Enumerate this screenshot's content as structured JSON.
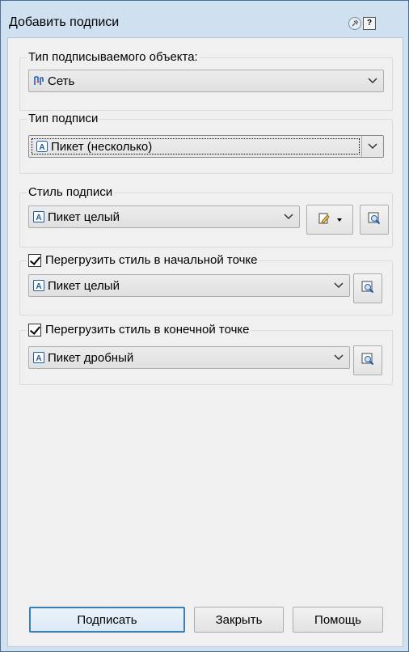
{
  "window": {
    "title": "Добавить подписи",
    "pin_icon": "pin-icon",
    "help_icon": "help-icon",
    "help_glyph": "?"
  },
  "object_type": {
    "label": "Тип подписываемого объекта:",
    "value": "Сеть",
    "icon": "network-icon"
  },
  "label_type": {
    "label": "Тип подписи",
    "value": "Пикет (несколько)",
    "icon": "label-icon"
  },
  "label_style": {
    "label": "Стиль подписи",
    "value": "Пикет целый",
    "icon": "label-style-icon",
    "edit_icon": "edit-style-icon",
    "preview_icon": "preview-icon"
  },
  "override_start": {
    "label": "Перегрузить стиль в начальной точке",
    "checked": true,
    "value": "Пикет целый",
    "icon": "label-style-icon"
  },
  "override_end": {
    "label": "Перегрузить стиль в конечной точке",
    "checked": true,
    "value": "Пикет дробный",
    "icon": "label-style-icon"
  },
  "buttons": {
    "label_btn": "Подписать",
    "close_btn": "Закрыть",
    "help_btn": "Помощь"
  }
}
